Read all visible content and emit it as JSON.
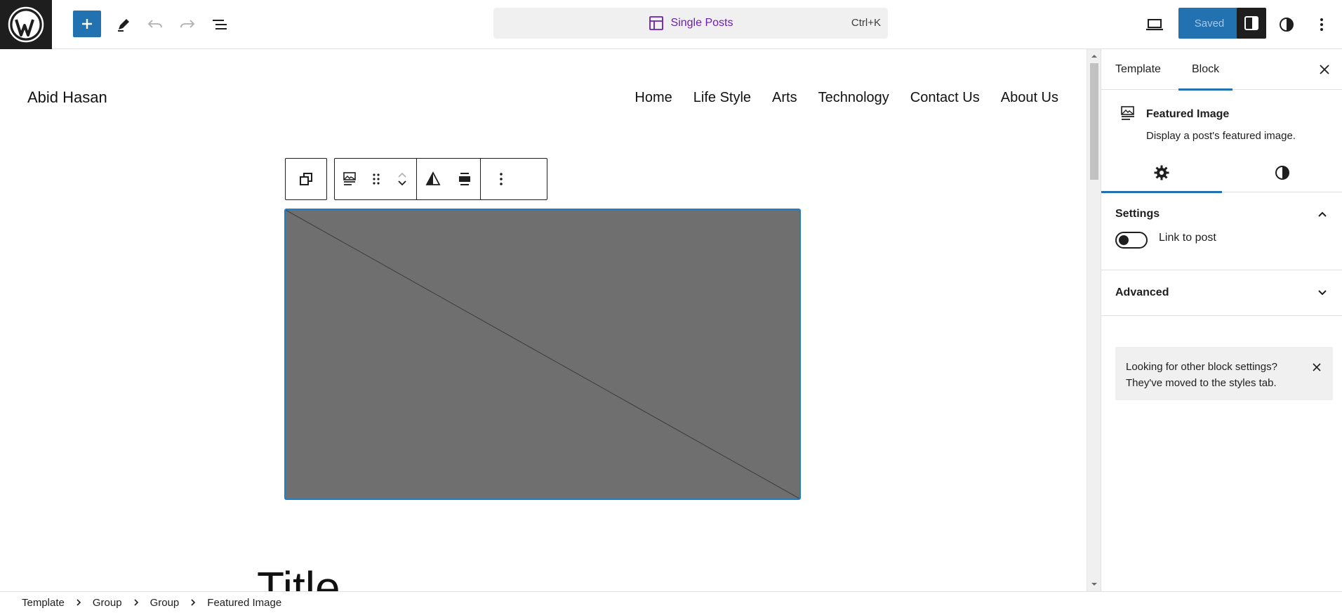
{
  "topbar": {
    "command_label": "Single Posts",
    "command_shortcut": "Ctrl+K",
    "saved_label": "Saved"
  },
  "canvas": {
    "site_title": "Abid Hasan",
    "nav": [
      "Home",
      "Life Style",
      "Arts",
      "Technology",
      "Contact Us",
      "About Us"
    ],
    "post_title": "Title"
  },
  "sidebar": {
    "tabs": [
      "Template",
      "Block"
    ],
    "block_title": "Featured Image",
    "block_desc": "Display a post's featured image.",
    "settings_label": "Settings",
    "link_to_post_label": "Link to post",
    "advanced_label": "Advanced",
    "notice_text": "Looking for other block settings? They've moved to the styles tab."
  },
  "breadcrumb": [
    "Template",
    "Group",
    "Group",
    "Featured Image"
  ],
  "colors": {
    "accent": "#2271b1",
    "command_text": "#6a1fb0",
    "placeholder": "#6f6f6f"
  }
}
